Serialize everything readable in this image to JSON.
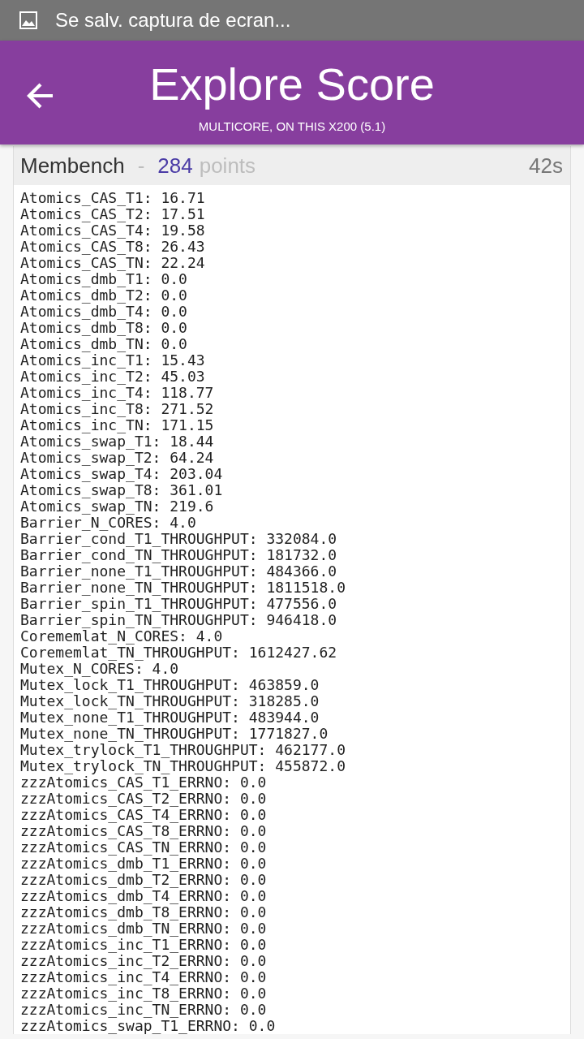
{
  "status_bar": {
    "notification": "Se salv. captura de ecran..."
  },
  "app_bar": {
    "title": "Explore Score",
    "subtitle": "MULTICORE, ON THIS X200 (5.1)"
  },
  "result": {
    "name": "Membench",
    "separator": "-",
    "score": "284",
    "unit": "points",
    "duration": "42s",
    "lines": [
      "Atomics_CAS_T1: 16.71",
      "Atomics_CAS_T2: 17.51",
      "Atomics_CAS_T4: 19.58",
      "Atomics_CAS_T8: 26.43",
      "Atomics_CAS_TN: 22.24",
      "Atomics_dmb_T1: 0.0",
      "Atomics_dmb_T2: 0.0",
      "Atomics_dmb_T4: 0.0",
      "Atomics_dmb_T8: 0.0",
      "Atomics_dmb_TN: 0.0",
      "Atomics_inc_T1: 15.43",
      "Atomics_inc_T2: 45.03",
      "Atomics_inc_T4: 118.77",
      "Atomics_inc_T8: 271.52",
      "Atomics_inc_TN: 171.15",
      "Atomics_swap_T1: 18.44",
      "Atomics_swap_T2: 64.24",
      "Atomics_swap_T4: 203.04",
      "Atomics_swap_T8: 361.01",
      "Atomics_swap_TN: 219.6",
      "Barrier_N_CORES: 4.0",
      "Barrier_cond_T1_THROUGHPUT: 332084.0",
      "Barrier_cond_TN_THROUGHPUT: 181732.0",
      "Barrier_none_T1_THROUGHPUT: 484366.0",
      "Barrier_none_TN_THROUGHPUT: 1811518.0",
      "Barrier_spin_T1_THROUGHPUT: 477556.0",
      "Barrier_spin_TN_THROUGHPUT: 946418.0",
      "Corememlat_N_CORES: 4.0",
      "Corememlat_TN_THROUGHPUT: 1612427.62",
      "Mutex_N_CORES: 4.0",
      "Mutex_lock_T1_THROUGHPUT: 463859.0",
      "Mutex_lock_TN_THROUGHPUT: 318285.0",
      "Mutex_none_T1_THROUGHPUT: 483944.0",
      "Mutex_none_TN_THROUGHPUT: 1771827.0",
      "Mutex_trylock_T1_THROUGHPUT: 462177.0",
      "Mutex_trylock_TN_THROUGHPUT: 455872.0",
      "zzzAtomics_CAS_T1_ERRNO: 0.0",
      "zzzAtomics_CAS_T2_ERRNO: 0.0",
      "zzzAtomics_CAS_T4_ERRNO: 0.0",
      "zzzAtomics_CAS_T8_ERRNO: 0.0",
      "zzzAtomics_CAS_TN_ERRNO: 0.0",
      "zzzAtomics_dmb_T1_ERRNO: 0.0",
      "zzzAtomics_dmb_T2_ERRNO: 0.0",
      "zzzAtomics_dmb_T4_ERRNO: 0.0",
      "zzzAtomics_dmb_T8_ERRNO: 0.0",
      "zzzAtomics_dmb_TN_ERRNO: 0.0",
      "zzzAtomics_inc_T1_ERRNO: 0.0",
      "zzzAtomics_inc_T2_ERRNO: 0.0",
      "zzzAtomics_inc_T4_ERRNO: 0.0",
      "zzzAtomics_inc_T8_ERRNO: 0.0",
      "zzzAtomics_inc_TN_ERRNO: 0.0",
      "zzzAtomics_swap_T1_ERRNO: 0.0"
    ]
  }
}
